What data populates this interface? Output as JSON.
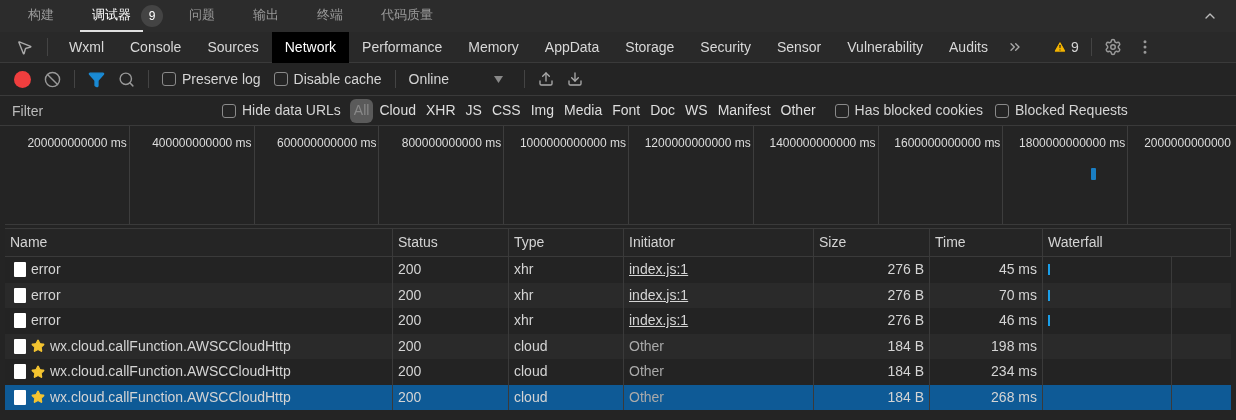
{
  "panel_tabs": [
    {
      "label": "构建",
      "selected": false
    },
    {
      "label": "调试器",
      "selected": true,
      "badge": "9"
    },
    {
      "label": "问题",
      "selected": false
    },
    {
      "label": "输出",
      "selected": false
    },
    {
      "label": "终端",
      "selected": false
    },
    {
      "label": "代码质量",
      "selected": false
    }
  ],
  "devtools_tabs": [
    {
      "label": "Wxml",
      "selected": false
    },
    {
      "label": "Console",
      "selected": false
    },
    {
      "label": "Sources",
      "selected": false
    },
    {
      "label": "Network",
      "selected": true
    },
    {
      "label": "Performance",
      "selected": false
    },
    {
      "label": "Memory",
      "selected": false
    },
    {
      "label": "AppData",
      "selected": false
    },
    {
      "label": "Storage",
      "selected": false
    },
    {
      "label": "Security",
      "selected": false
    },
    {
      "label": "Sensor",
      "selected": false
    },
    {
      "label": "Vulnerability",
      "selected": false
    },
    {
      "label": "Audits",
      "selected": false
    }
  ],
  "warnings": "9",
  "toolbar": {
    "recording": true,
    "preserve_log": {
      "label": "Preserve log",
      "checked": false
    },
    "disable_cache": {
      "label": "Disable cache",
      "checked": false
    },
    "throttling": "Online"
  },
  "filter": {
    "placeholder": "Filter",
    "hide_data_urls": {
      "label": "Hide data URLs",
      "checked": false
    },
    "types": [
      {
        "label": "All",
        "selected": true
      },
      {
        "label": "Cloud",
        "selected": false
      },
      {
        "label": "XHR",
        "selected": false
      },
      {
        "label": "JS",
        "selected": false
      },
      {
        "label": "CSS",
        "selected": false
      },
      {
        "label": "Img",
        "selected": false
      },
      {
        "label": "Media",
        "selected": false
      },
      {
        "label": "Font",
        "selected": false
      },
      {
        "label": "Doc",
        "selected": false
      },
      {
        "label": "WS",
        "selected": false
      },
      {
        "label": "Manifest",
        "selected": false
      },
      {
        "label": "Other",
        "selected": false
      }
    ],
    "has_blocked_cookies": {
      "label": "Has blocked cookies",
      "checked": false
    },
    "blocked_requests": {
      "label": "Blocked Requests",
      "checked": false
    }
  },
  "overview_ticks": [
    "200000000000 ms",
    "400000000000 ms",
    "600000000000 ms",
    "800000000000 ms",
    "1000000000000 ms",
    "1200000000000 ms",
    "1400000000000 ms",
    "1600000000000 ms",
    "1800000000000 ms",
    "2000000000000"
  ],
  "table": {
    "columns": [
      "Name",
      "Status",
      "Type",
      "Initiator",
      "Size",
      "Time",
      "Waterfall"
    ],
    "rows": [
      {
        "name": "error",
        "starred": false,
        "status": "200",
        "type": "xhr",
        "initiator": "index.js:1",
        "initiator_link": true,
        "size": "276 B",
        "time": "45 ms",
        "waterfall_bar": true,
        "selected": false
      },
      {
        "name": "error",
        "starred": false,
        "status": "200",
        "type": "xhr",
        "initiator": "index.js:1",
        "initiator_link": true,
        "size": "276 B",
        "time": "70 ms",
        "waterfall_bar": true,
        "selected": false
      },
      {
        "name": "error",
        "starred": false,
        "status": "200",
        "type": "xhr",
        "initiator": "index.js:1",
        "initiator_link": true,
        "size": "276 B",
        "time": "46 ms",
        "waterfall_bar": true,
        "selected": false
      },
      {
        "name": "wx.cloud.callFunction.AWSCCloudHttp",
        "starred": true,
        "status": "200",
        "type": "cloud",
        "initiator": "Other",
        "initiator_link": false,
        "size": "184 B",
        "time": "198 ms",
        "waterfall_bar": false,
        "selected": false
      },
      {
        "name": "wx.cloud.callFunction.AWSCCloudHttp",
        "starred": true,
        "status": "200",
        "type": "cloud",
        "initiator": "Other",
        "initiator_link": false,
        "size": "184 B",
        "time": "234 ms",
        "waterfall_bar": false,
        "selected": false
      },
      {
        "name": "wx.cloud.callFunction.AWSCCloudHttp",
        "starred": true,
        "status": "200",
        "type": "cloud",
        "initiator": "Other",
        "initiator_link": false,
        "size": "184 B",
        "time": "268 ms",
        "waterfall_bar": false,
        "selected": true
      }
    ]
  }
}
